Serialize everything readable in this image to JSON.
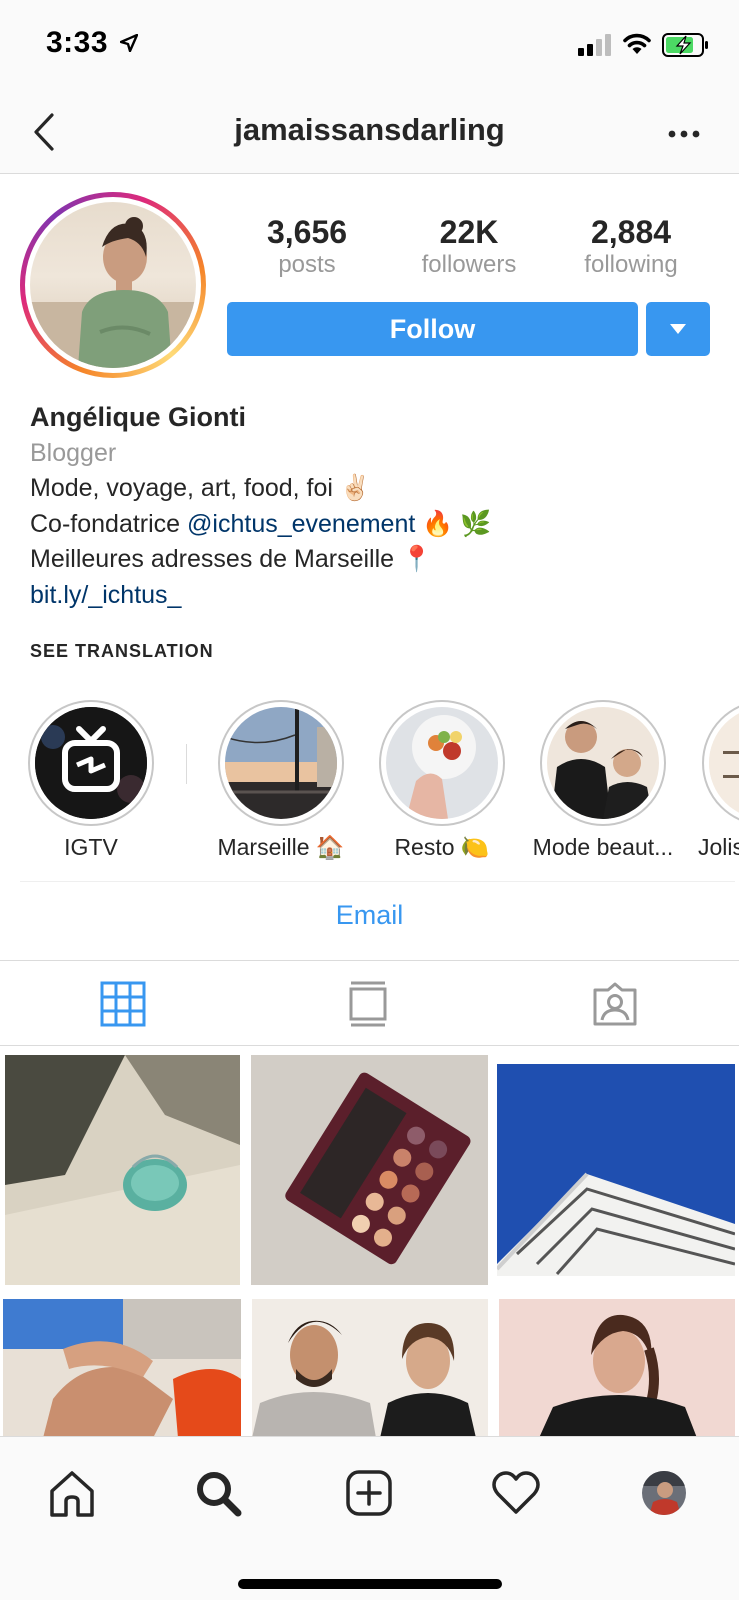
{
  "status_bar": {
    "time": "3:33"
  },
  "nav": {
    "title": "jamaissansdarling"
  },
  "profile": {
    "stats": [
      {
        "value": "3,656",
        "label": "posts"
      },
      {
        "value": "22K",
        "label": "followers"
      },
      {
        "value": "2,884",
        "label": "following"
      }
    ],
    "follow_label": "Follow",
    "name": "Angélique Gionti",
    "category": "Blogger",
    "bio_line1": "Mode, voyage, art, food, foi ✌🏻",
    "bio_line2_prefix": "Co-fondatrice ",
    "bio_line2_mention": "@ichtus_evenement",
    "bio_line2_suffix": "  🔥 🌿",
    "bio_line3": "Meilleures adresses de Marseille 📍",
    "website": "bit.ly/_ichtus_",
    "see_translation": "SEE TRANSLATION"
  },
  "highlights": [
    {
      "label": "IGTV"
    },
    {
      "label": "Marseille 🏠"
    },
    {
      "label": "Resto 🍋"
    },
    {
      "label": "Mode beaut..."
    },
    {
      "label": "Jolis"
    }
  ],
  "contact": {
    "email_label": "Email"
  },
  "tabs": [
    {
      "icon": "grid-icon",
      "active": true
    },
    {
      "icon": "feed-icon",
      "active": false
    },
    {
      "icon": "tagged-icon",
      "active": false
    }
  ],
  "bottom_nav": [
    {
      "icon": "home-icon"
    },
    {
      "icon": "search-icon"
    },
    {
      "icon": "new-post-icon"
    },
    {
      "icon": "activity-heart-icon"
    },
    {
      "icon": "profile-avatar"
    }
  ],
  "colors": {
    "accent": "#3897f0",
    "link": "#003569",
    "muted": "#999999",
    "text": "#262626"
  }
}
